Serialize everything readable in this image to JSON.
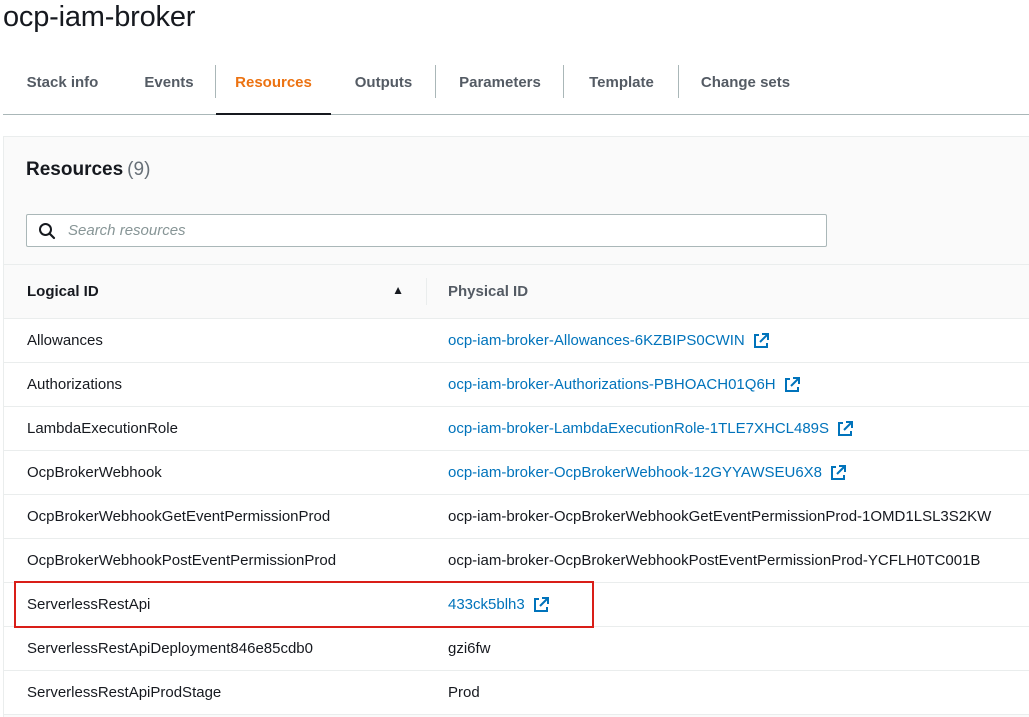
{
  "stack": {
    "title": "ocp-iam-broker"
  },
  "tabs": [
    {
      "label": "Stack info",
      "active": false
    },
    {
      "label": "Events",
      "active": false
    },
    {
      "label": "Resources",
      "active": true
    },
    {
      "label": "Outputs",
      "active": false
    },
    {
      "label": "Parameters",
      "active": false
    },
    {
      "label": "Template",
      "active": false
    },
    {
      "label": "Change sets",
      "active": false
    }
  ],
  "resources": {
    "title": "Resources",
    "count": "(9)",
    "search": {
      "placeholder": "Search resources",
      "value": ""
    },
    "columns": {
      "logical_id": "Logical ID",
      "physical_id": "Physical ID"
    },
    "sort": {
      "column": "Logical ID",
      "direction": "ascending"
    },
    "rows": [
      {
        "logical_id": "Allowances",
        "physical_id": "ocp-iam-broker-Allowances-6KZBIPS0CWIN",
        "link": true
      },
      {
        "logical_id": "Authorizations",
        "physical_id": "ocp-iam-broker-Authorizations-PBHOACH01Q6H",
        "link": true
      },
      {
        "logical_id": "LambdaExecutionRole",
        "physical_id": "ocp-iam-broker-LambdaExecutionRole-1TLE7XHCL489S",
        "link": true
      },
      {
        "logical_id": "OcpBrokerWebhook",
        "physical_id": "ocp-iam-broker-OcpBrokerWebhook-12GYYAWSEU6X8",
        "link": true
      },
      {
        "logical_id": "OcpBrokerWebhookGetEventPermissionProd",
        "physical_id": "ocp-iam-broker-OcpBrokerWebhookGetEventPermissionProd-1OMD1LSL3S2KW",
        "link": false
      },
      {
        "logical_id": "OcpBrokerWebhookPostEventPermissionProd",
        "physical_id": "ocp-iam-broker-OcpBrokerWebhookPostEventPermissionProd-YCFLH0TC001B",
        "link": false
      },
      {
        "logical_id": "ServerlessRestApi",
        "physical_id": "433ck5blh3",
        "link": true
      },
      {
        "logical_id": "ServerlessRestApiDeployment846e85cdb0",
        "physical_id": "gzi6fw",
        "link": false
      },
      {
        "logical_id": "ServerlessRestApiProdStage",
        "physical_id": "Prod",
        "link": false
      }
    ]
  },
  "colors": {
    "accent": "#ec7211",
    "link": "#0073bb",
    "highlight": "#d91e18"
  },
  "icons": {
    "search": "search-icon",
    "external": "external-link-icon",
    "sort": "sort-ascending-icon"
  }
}
